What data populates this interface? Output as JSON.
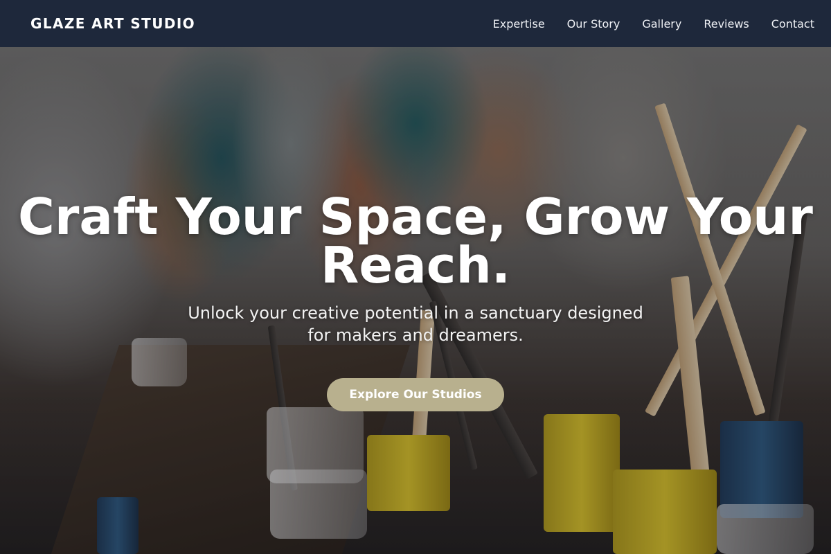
{
  "nav": {
    "brand": "GLAZE ART STUDIO",
    "links": [
      {
        "label": "Expertise"
      },
      {
        "label": "Our Story"
      },
      {
        "label": "Gallery"
      },
      {
        "label": "Reviews"
      },
      {
        "label": "Contact"
      }
    ]
  },
  "hero": {
    "title": "Craft Your Space, Grow Your Reach.",
    "subtitle": "Unlock your creative potential in a sanctuary designed for makers and dreamers.",
    "cta_label": "Explore Our Studios"
  },
  "colors": {
    "navbar_bg": "#1e283b",
    "cta_bg": "#b8b08e",
    "text": "#ffffff"
  }
}
